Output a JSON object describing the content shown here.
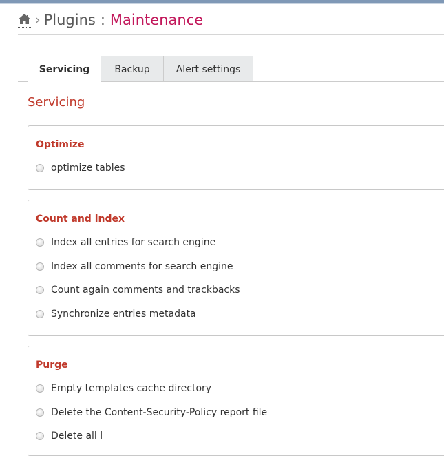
{
  "breadcrumb": {
    "home_icon": "home-icon",
    "separator": "›",
    "plugins": "Plugins",
    "colon": ":",
    "current": "Maintenance"
  },
  "tabs": [
    {
      "label": "Servicing",
      "active": true
    },
    {
      "label": "Backup",
      "active": false
    },
    {
      "label": "Alert settings",
      "active": false
    }
  ],
  "section_title": "Servicing",
  "groups": {
    "optimize": {
      "legend": "Optimize",
      "options": [
        "optimize tables"
      ]
    },
    "count": {
      "legend": "Count and index",
      "options": [
        "Index all entries for search engine",
        "Index all comments for search engine",
        "Count again comments and trackbacks",
        "Synchronize entries metadata"
      ]
    },
    "purge": {
      "legend": "Purge",
      "options": [
        "Empty templates cache directory",
        "Delete the Content-Security-Policy report file",
        "Delete all l"
      ]
    }
  },
  "colors": {
    "accent": "#c0392b",
    "breadcrumb_current": "#c2185b",
    "topbar": "#7f98b6"
  }
}
